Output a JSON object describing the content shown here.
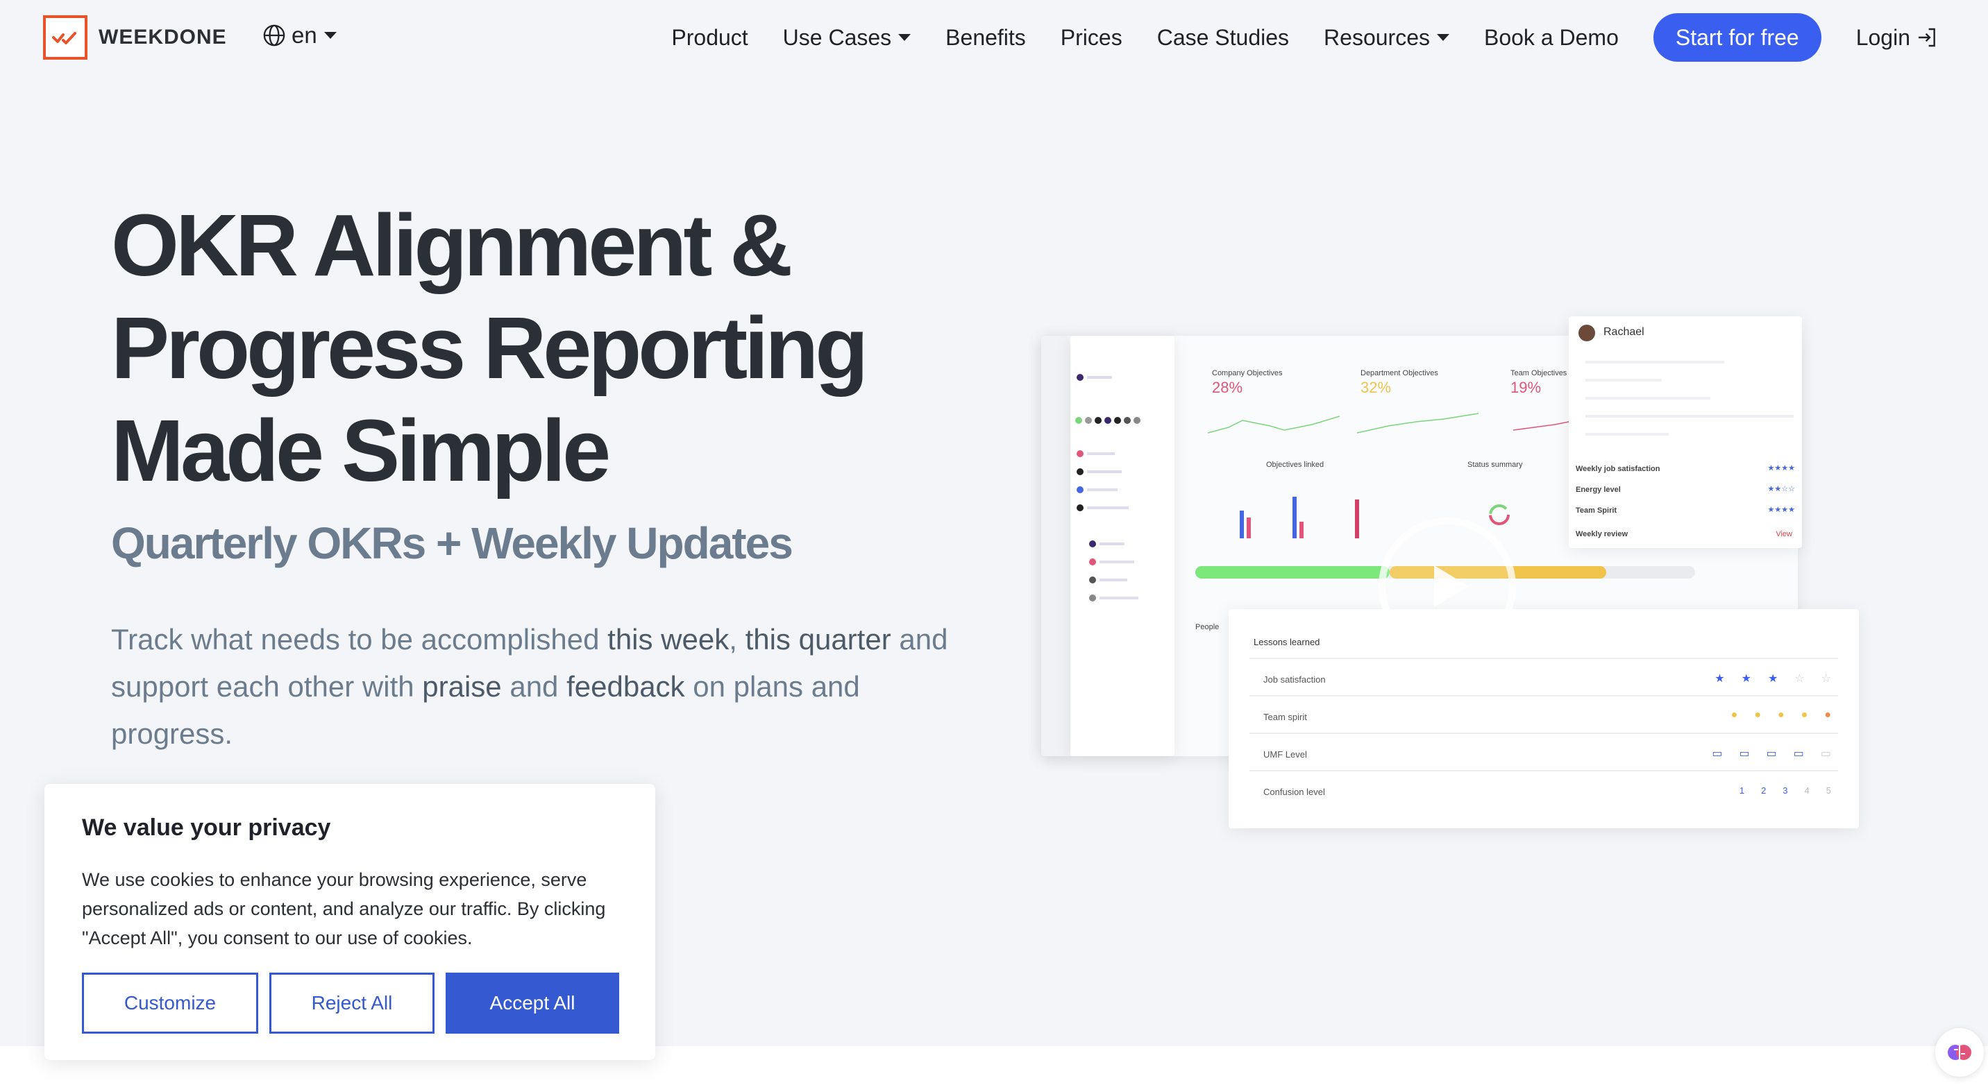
{
  "brand": {
    "name": "WEEKDONE",
    "accent": "#e8532b"
  },
  "lang": {
    "code": "en"
  },
  "nav": {
    "product": "Product",
    "use_cases": "Use Cases",
    "benefits": "Benefits",
    "prices": "Prices",
    "case_studies": "Case Studies",
    "resources": "Resources",
    "book_demo": "Book a Demo",
    "start": "Start for free",
    "login": "Login"
  },
  "hero": {
    "title_line1": "OKR Alignment &",
    "title_line2": "Progress Reporting",
    "title_line3": "Made Simple",
    "subtitle": "Quarterly OKRs + Weekly Updates",
    "desc_1": "Track what needs to be accomplished ",
    "desc_b1": "this week",
    "desc_2": ", ",
    "desc_b2": "this quarter",
    "desc_3": " and support each other with ",
    "desc_b3": "praise",
    "desc_4": " and ",
    "desc_b4": "feedback",
    "desc_5": " on plans and progress."
  },
  "mock": {
    "company_label": "Company Objectives",
    "company_pct": "28%",
    "dept_label": "Department Objectives",
    "dept_pct": "32%",
    "team_label": "Team Objectives",
    "team_pct": "19%",
    "linked_label": "Objectives linked",
    "status_label": "Status summary",
    "people_label": "People",
    "rachael": "Rachael",
    "weekly_job": "Weekly job satisfaction",
    "energy": "Energy level",
    "team_spirit_r": "Team Spirit",
    "weekly_review": "Weekly review",
    "view": "View",
    "lessons": "Lessons learned",
    "row1": "Job satisfaction",
    "row2": "Team spirit",
    "row3": "UMF Level",
    "row4": "Confusion level",
    "scale": [
      "1",
      "2",
      "3",
      "4",
      "5"
    ]
  },
  "cookie": {
    "title": "We value your privacy",
    "text": "We use cookies to enhance your browsing experience, serve personalized ads or content, and analyze our traffic. By clicking \"Accept All\", you consent to our use of cookies.",
    "customize": "Customize",
    "reject": "Reject All",
    "accept": "Accept All"
  }
}
